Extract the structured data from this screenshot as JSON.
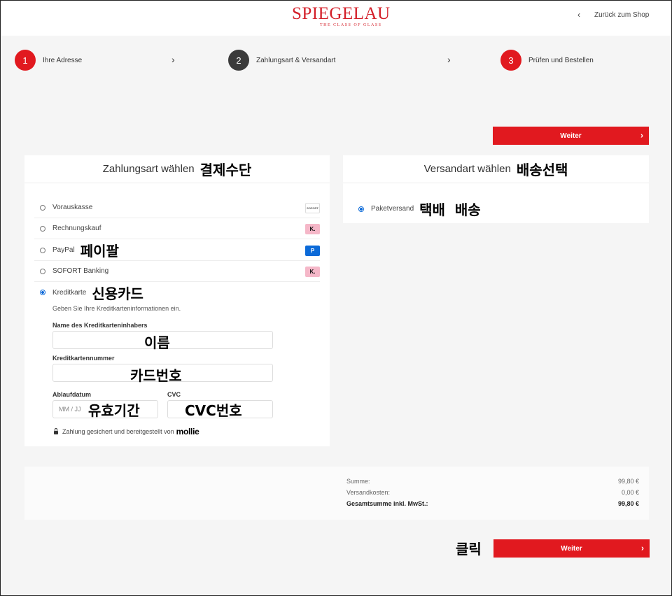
{
  "header": {
    "logo_text": "SPIEGELAU",
    "logo_tagline": "THE CLASS OF GLASS",
    "back_label": "Zurück zum Shop"
  },
  "steps": [
    {
      "num": "1",
      "label": "Ihre Adresse"
    },
    {
      "num": "2",
      "label": "Zahlungsart & Versandart"
    },
    {
      "num": "3",
      "label": "Prüfen und Bestellen"
    }
  ],
  "next_button": "Weiter",
  "payment": {
    "title": "Zahlungsart wählen",
    "title_annotation": "결제수단",
    "methods": [
      {
        "label": "Vorauskasse",
        "icon": "sofort-icon",
        "icon_text": "SOFORT",
        "annotation": ""
      },
      {
        "label": "Rechnungskauf",
        "icon": "klarna-icon",
        "icon_text": "K.",
        "annotation": ""
      },
      {
        "label": "PayPal",
        "icon": "paypal-icon",
        "icon_text": "P",
        "annotation": "페이팔"
      },
      {
        "label": "SOFORT Banking",
        "icon": "klarna-icon",
        "icon_text": "K.",
        "annotation": ""
      },
      {
        "label": "Kreditkarte",
        "icon": "",
        "icon_text": "",
        "annotation": "신용카드",
        "selected": true
      }
    ],
    "card_hint": "Geben Sie Ihre Kreditkarteninformationen ein.",
    "card_holder_label": "Name des Kreditkarteninhabers",
    "card_holder_annotation": "이름",
    "card_number_label": "Kreditkartennummer",
    "card_number_annotation": "카드번호",
    "expiry_label": "Ablaufdatum",
    "expiry_placeholder": "MM / JJ",
    "expiry_annotation": "유효기간",
    "cvc_label": "CVC",
    "cvc_annotation": "CVC번호",
    "secure_text": "Zahlung gesichert und bereitgestellt von",
    "secure_brand": "mollie"
  },
  "shipping": {
    "title": "Versandart wählen",
    "title_annotation": "배송선택",
    "method": "Paketversand",
    "method_annotation": "택배  배송"
  },
  "summary": {
    "rows": [
      {
        "label": "Summe:",
        "value": "99,80 €"
      },
      {
        "label": "Versandkosten:",
        "value": "0,00 €"
      },
      {
        "label": "Gesamtsumme inkl. MwSt.:",
        "value": "99,80 €"
      }
    ]
  },
  "click_annotation": "클릭",
  "colors": {
    "accent": "#e1191f",
    "step_active": "#3b3b3b",
    "radio": "#0b6ad8"
  }
}
